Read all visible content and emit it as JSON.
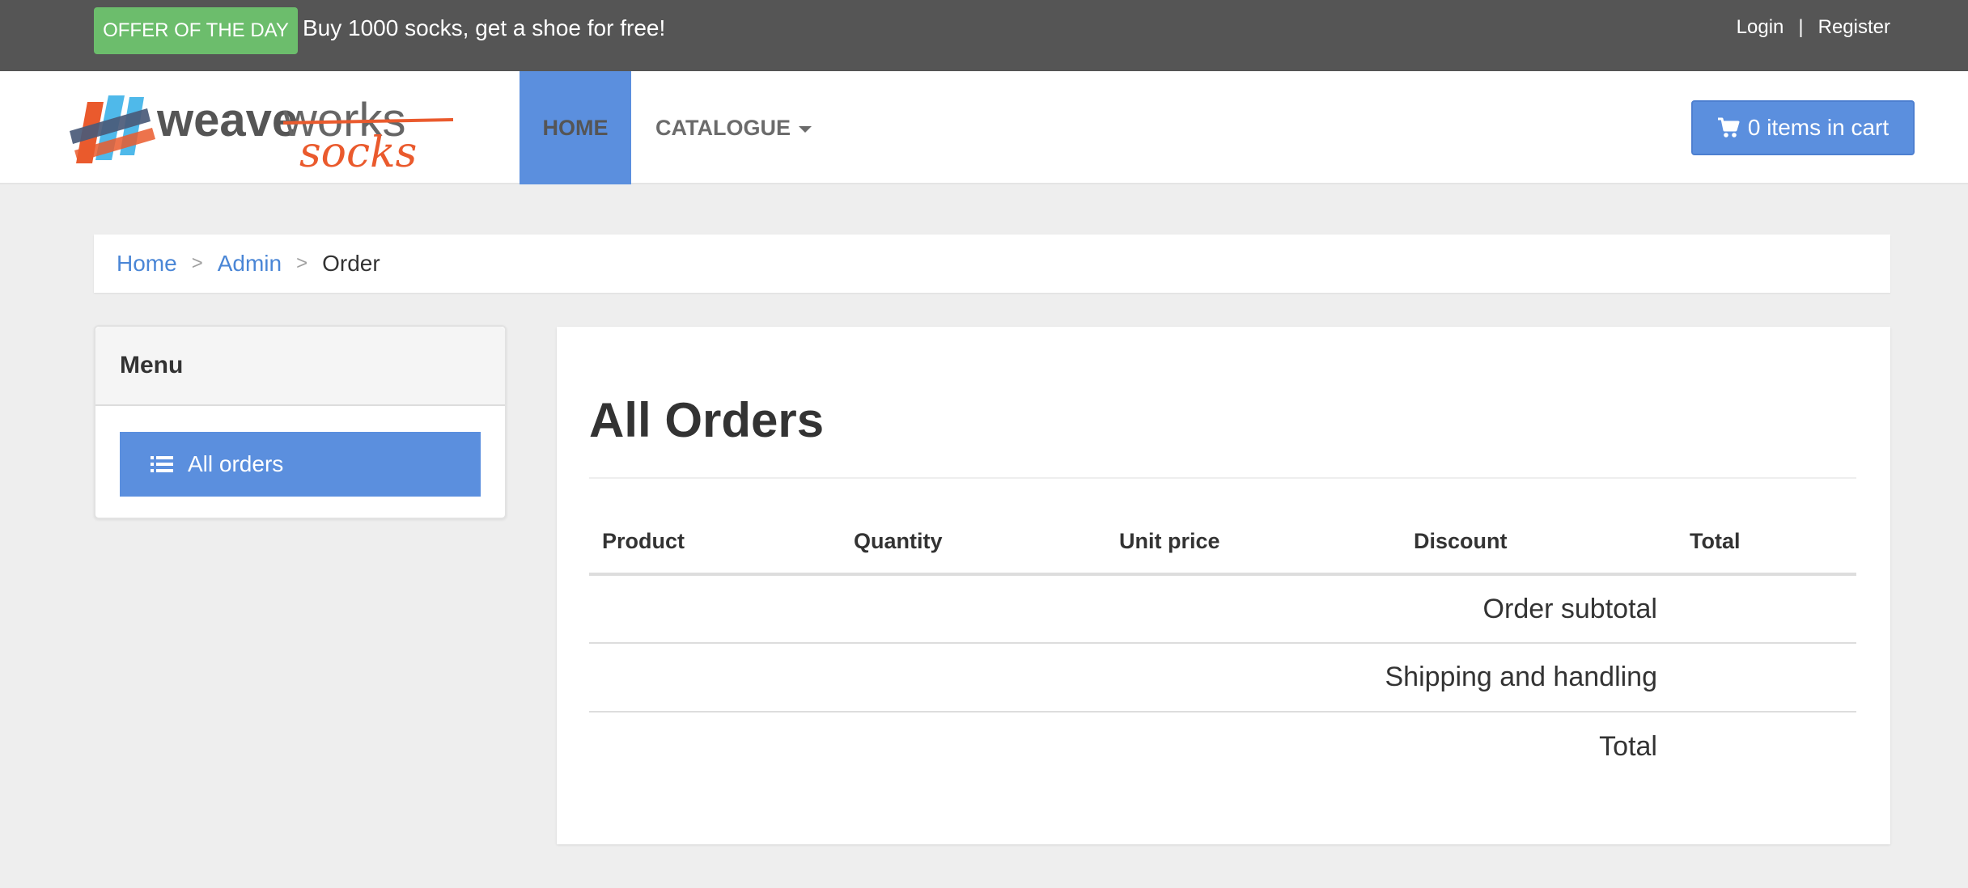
{
  "topbar": {
    "offer_badge": "OFFER OF THE DAY",
    "offer_text": "Buy 1000 socks, get a shoe for free!",
    "login": "Login",
    "separator": "|",
    "register": "Register"
  },
  "brand": {
    "name_weave": "weave",
    "name_works": "works",
    "name_socks": "socks"
  },
  "nav": {
    "home": "HOME",
    "catalogue": "CATALOGUE",
    "cart": "0 items in cart"
  },
  "breadcrumb": {
    "home": "Home",
    "admin": "Admin",
    "current": "Order",
    "sep": ">"
  },
  "sidebar": {
    "title": "Menu",
    "items": [
      {
        "label": "All orders",
        "icon": "list-icon"
      }
    ]
  },
  "main": {
    "title": "All Orders",
    "table": {
      "headers": [
        "Product",
        "Quantity",
        "Unit price",
        "Discount",
        "Total"
      ],
      "summary_rows": [
        "Order subtotal",
        "Shipping and handling",
        "Total"
      ]
    }
  },
  "colors": {
    "topbar_bg": "#555555",
    "offer_green": "#6cbd6c",
    "accent_blue": "#5b8fde",
    "link_blue": "#4a86d6",
    "page_bg": "#eeeeee",
    "logo_orange": "#ea5a2d"
  }
}
